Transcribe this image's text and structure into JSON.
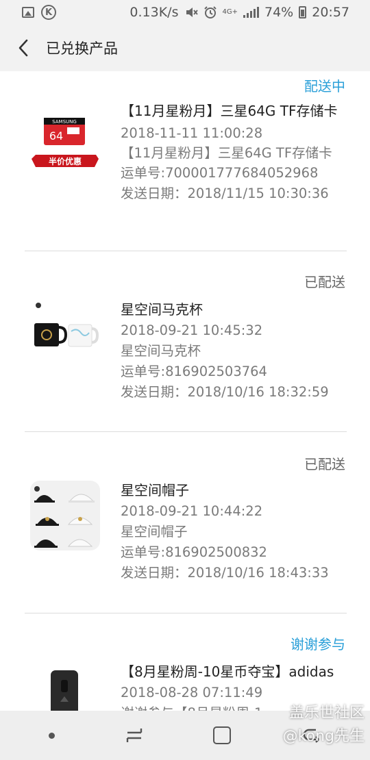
{
  "status_bar": {
    "network_speed": "0.13K/s",
    "network_type": "4G+",
    "battery": "74%",
    "time": "20:57",
    "icons": [
      "image-icon",
      "k-icon",
      "mute-icon",
      "alarm-icon",
      "signal-icon",
      "battery-icon"
    ]
  },
  "header": {
    "back_icon": "chevron-left-icon",
    "title": "已兑换产品"
  },
  "items": [
    {
      "status": "配送中",
      "status_color": "#2a9fd8",
      "name": "【11月星粉月】三星64G TF存储卡",
      "date": "2018-11-11 11:00:28",
      "description": "【11月星粉月】三星64G TF存储卡",
      "tracking": "运单号:700001777684052968",
      "ship_date": "发送日期：2018/11/15 10:30:36",
      "thumb": {
        "brand": "SAMSUNG",
        "capacity": "64",
        "badge": "半价优惠"
      }
    },
    {
      "status": "已配送",
      "status_color": "#666666",
      "name": "星空间马克杯",
      "date": "2018-09-21 10:45:32",
      "description": "星空间马克杯",
      "tracking": "运单号:816902503764",
      "ship_date": "发送日期：2018/10/16 18:32:59",
      "thumb": {
        "kind": "mugs"
      }
    },
    {
      "status": "已配送",
      "status_color": "#666666",
      "name": "星空间帽子",
      "date": "2018-09-21 10:44:22",
      "description": "星空间帽子",
      "tracking": "运单号:816902500832",
      "ship_date": "发送日期：2018/10/16 18:43:33",
      "thumb": {
        "kind": "caps"
      }
    },
    {
      "status": "谢谢参与",
      "status_color": "#2a9fd8",
      "name": "【8月星粉周-10星币夺宝】adidas",
      "date": "2018-08-28 07:11:49",
      "description": "谢谢参与【8月星粉周-1",
      "thumb": {
        "kind": "phone-case"
      }
    }
  ],
  "nav_bar": {
    "icons": [
      "assist-dot-icon",
      "recent-apps-icon",
      "home-icon",
      "back-icon"
    ]
  },
  "watermark": {
    "site": "盖乐世社区",
    "user": "@kong先生"
  }
}
